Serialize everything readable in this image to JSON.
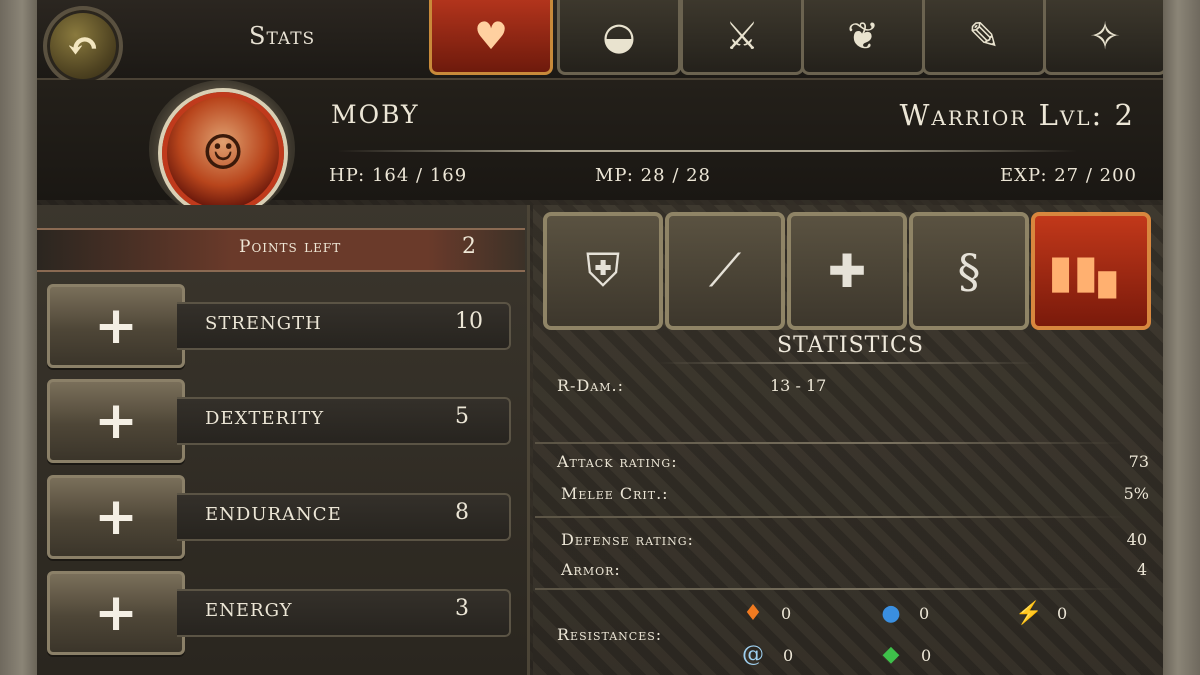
{
  "header": {
    "title": "Stats",
    "character_name": "MOBY",
    "class_level": "Warrior Lvl: 2",
    "hp": "HP: 164 / 169",
    "mp": "MP: 28 / 28",
    "exp": "EXP: 27 / 200"
  },
  "tabs": [
    {
      "name": "heart",
      "icon": "heart-icon",
      "active": true
    },
    {
      "name": "bag",
      "icon": "bag-icon",
      "active": false
    },
    {
      "name": "sword",
      "icon": "sword-icon",
      "active": false
    },
    {
      "name": "wings",
      "icon": "wings-icon",
      "active": false
    },
    {
      "name": "scroll",
      "icon": "scroll-icon",
      "active": false
    },
    {
      "name": "map",
      "icon": "map-icon",
      "active": false
    }
  ],
  "attributes": {
    "points_left_label": "Points left",
    "points_left": "2",
    "items": [
      {
        "label": "STRENGTH",
        "value": "10"
      },
      {
        "label": "DEXTERITY",
        "value": "5"
      },
      {
        "label": "ENDURANCE",
        "value": "8"
      },
      {
        "label": "ENERGY",
        "value": "3"
      }
    ]
  },
  "category_tabs": [
    {
      "icon": "shield-icon",
      "active": false
    },
    {
      "icon": "blade-icon",
      "active": false
    },
    {
      "icon": "cross-icon",
      "active": false
    },
    {
      "icon": "staff-icon",
      "active": false
    },
    {
      "icon": "bar-chart-icon",
      "active": true
    }
  ],
  "statistics": {
    "title": "STATISTICS",
    "r_dam_label": "R-Dam.:",
    "r_dam_value": "13 - 17",
    "attack_rating_label": "Attack rating:",
    "attack_rating_value": "73",
    "melee_crit_label": "Melee Crit.:",
    "melee_crit_value": "5%",
    "defense_rating_label": "Defense rating:",
    "defense_rating_value": "40",
    "armor_label": "Armor:",
    "armor_value": "4",
    "resistances_label": "Resistances:",
    "resistances": [
      {
        "type": "fire",
        "icon": "fire-icon",
        "value": "0",
        "color": "#f07a20"
      },
      {
        "type": "water",
        "icon": "water-drop-icon",
        "value": "0",
        "color": "#3a8fe0"
      },
      {
        "type": "lightning",
        "icon": "lightning-icon",
        "value": "0",
        "color": "#f2c21a"
      },
      {
        "type": "wind",
        "icon": "swirl-icon",
        "value": "0",
        "color": "#9fd0f0"
      },
      {
        "type": "poison",
        "icon": "gem-icon",
        "value": "0",
        "color": "#3ec04a"
      }
    ]
  }
}
